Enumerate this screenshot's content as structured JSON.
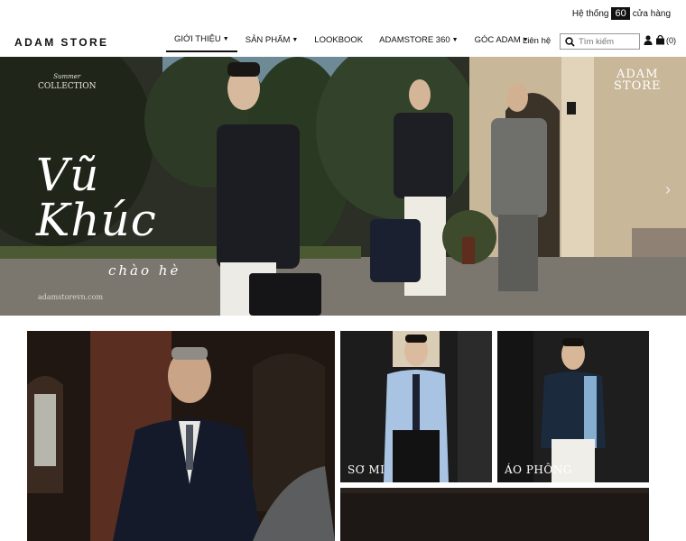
{
  "topbar": {
    "store_prefix": "Hệ thống",
    "store_count": "60",
    "store_suffix": "cửa hàng"
  },
  "brand": {
    "logo": "ADAM STORE"
  },
  "nav": {
    "items": [
      {
        "label": "GIỚI THIỆU",
        "dropdown": true,
        "active": true
      },
      {
        "label": "SẢN PHẨM",
        "dropdown": true
      },
      {
        "label": "LOOKBOOK",
        "dropdown": false
      },
      {
        "label": "ADAMSTORE 360",
        "dropdown": true
      },
      {
        "label": "GÓC ADAM",
        "dropdown": true
      }
    ],
    "contact": "Liên hệ"
  },
  "search": {
    "placeholder": "Tìm kiếm",
    "icon": "search-icon"
  },
  "account": {
    "icon": "user-icon"
  },
  "cart": {
    "icon": "cart-icon",
    "count": "(0)"
  },
  "hero": {
    "collection_small": "Summer",
    "collection": "COLLECTION",
    "title_line1": "Vũ",
    "title_line2": "Khúc",
    "script": "chào hè",
    "url": "adamstorevn.com",
    "brand_line1": "ADAM",
    "brand_line2": "STORE",
    "next_icon": "chevron-right-icon"
  },
  "tiles": [
    {
      "label": ""
    },
    {
      "label": "SƠ MI"
    },
    {
      "label": "ÁO PHÔNG"
    },
    {
      "label": ""
    }
  ],
  "colors": {
    "text": "#111111",
    "hero_bg": "#2a2d22",
    "tile_bg": "#1a1a1a"
  }
}
